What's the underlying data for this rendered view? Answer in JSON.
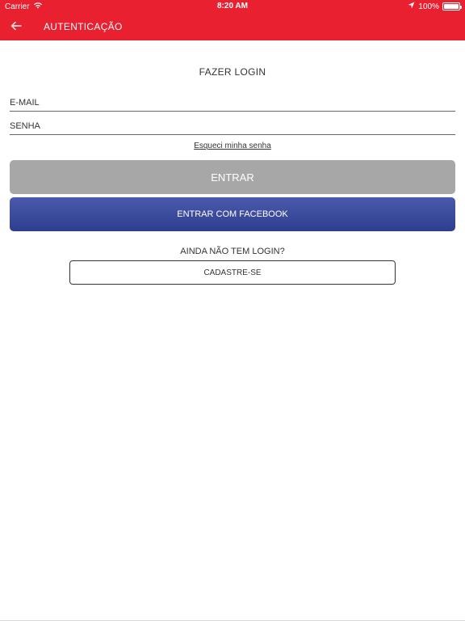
{
  "status_bar": {
    "carrier": "Carrier",
    "time": "8:20 AM",
    "battery": "100%"
  },
  "navbar": {
    "title": "AUTENTICAÇÃO"
  },
  "login": {
    "heading": "FAZER LOGIN",
    "email_placeholder": "E-MAIL",
    "password_placeholder": "SENHA",
    "forgot_label": "Esqueci minha senha",
    "enter_label": "ENTRAR",
    "facebook_label": "ENTRAR COM FACEBOOK",
    "no_account_label": "AINDA NÃO TEM LOGIN?",
    "signup_label": "CADASTRE-SE"
  },
  "colors": {
    "brand_red": "#e8202f",
    "facebook_blue": "#3b4ba0",
    "disabled_gray": "#a7a7a7"
  },
  "icons": {
    "back": "arrow-left-icon",
    "wifi": "wifi-icon",
    "location": "location-arrow-icon",
    "battery": "battery-icon"
  }
}
